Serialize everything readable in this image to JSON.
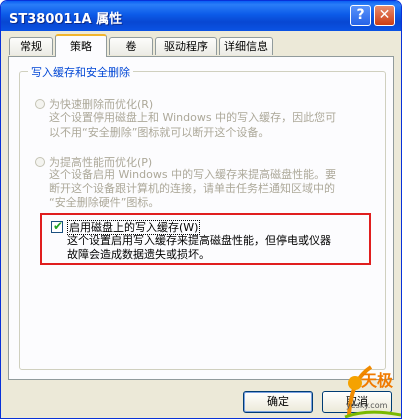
{
  "window": {
    "title": "ST380011A 属性",
    "help_label": "?",
    "close_label": "✕"
  },
  "tabs": [
    "常规",
    "策略",
    "卷",
    "驱动程序",
    "详细信息"
  ],
  "active_tab": "策略",
  "group": {
    "title": "写入缓存和安全删除",
    "option_quick": {
      "label": "为快速删除而优化(R)",
      "desc": [
        "这个设置停用磁盘上和 Windows 中的写入缓存，因此您可",
        "以不用“安全删除”图标就可以断开这个设备。"
      ]
    },
    "option_performance": {
      "label": "为提高性能而优化(P)",
      "desc": [
        "这个设备启用 Windows 中的写入缓存来提高磁盘性能。要",
        "断开这个设备跟计算机的连接，请单击任务栏通知区域中的",
        "“安全删除硬件”图标。"
      ]
    },
    "write_cache": {
      "label": "启用磁盘上的写入缓存(W)",
      "checked": true,
      "desc": [
        "这个设置启用写入缓存来提高磁盘性能，但停电或仪器",
        "故障会造成数据遗失或损坏。"
      ]
    }
  },
  "buttons": {
    "ok": "确定",
    "cancel": "取消"
  },
  "watermark": {
    "brand": "天极",
    "url": "yesky.com"
  },
  "colors": {
    "highlight_border": "#e01e1e",
    "group_title": "#0046d5",
    "tab_accent": "#f1b52c"
  }
}
